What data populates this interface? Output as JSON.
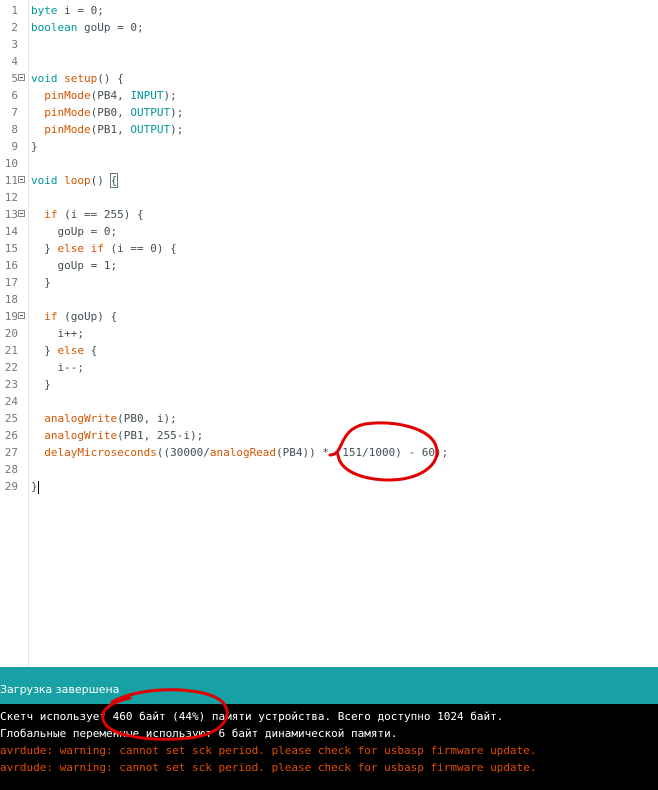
{
  "editor": {
    "lines": [
      {
        "n": "1",
        "fold": false,
        "tokens": [
          {
            "t": "byte",
            "c": "kw"
          },
          {
            "t": " i = 0;",
            "c": ""
          }
        ]
      },
      {
        "n": "2",
        "fold": false,
        "tokens": [
          {
            "t": "boolean",
            "c": "kw"
          },
          {
            "t": " goUp = 0;",
            "c": ""
          }
        ]
      },
      {
        "n": "3",
        "fold": false,
        "tokens": []
      },
      {
        "n": "4",
        "fold": false,
        "tokens": []
      },
      {
        "n": "5",
        "fold": true,
        "tokens": [
          {
            "t": "void",
            "c": "kw"
          },
          {
            "t": " ",
            "c": ""
          },
          {
            "t": "setup",
            "c": "fn"
          },
          {
            "t": "() {",
            "c": ""
          }
        ]
      },
      {
        "n": "6",
        "fold": false,
        "tokens": [
          {
            "t": "  ",
            "c": ""
          },
          {
            "t": "pinMode",
            "c": "fn"
          },
          {
            "t": "(PB4, ",
            "c": ""
          },
          {
            "t": "INPUT",
            "c": "cn"
          },
          {
            "t": ");",
            "c": ""
          }
        ]
      },
      {
        "n": "7",
        "fold": false,
        "tokens": [
          {
            "t": "  ",
            "c": ""
          },
          {
            "t": "pinMode",
            "c": "fn"
          },
          {
            "t": "(PB0, ",
            "c": ""
          },
          {
            "t": "OUTPUT",
            "c": "cn"
          },
          {
            "t": ");",
            "c": ""
          }
        ]
      },
      {
        "n": "8",
        "fold": false,
        "tokens": [
          {
            "t": "  ",
            "c": ""
          },
          {
            "t": "pinMode",
            "c": "fn"
          },
          {
            "t": "(PB1, ",
            "c": ""
          },
          {
            "t": "OUTPUT",
            "c": "cn"
          },
          {
            "t": ");",
            "c": ""
          }
        ]
      },
      {
        "n": "9",
        "fold": false,
        "tokens": [
          {
            "t": "}",
            "c": ""
          }
        ]
      },
      {
        "n": "10",
        "fold": false,
        "tokens": []
      },
      {
        "n": "11",
        "fold": true,
        "tokens": [
          {
            "t": "void",
            "c": "kw"
          },
          {
            "t": " ",
            "c": ""
          },
          {
            "t": "loop",
            "c": "fn"
          },
          {
            "t": "() ",
            "c": ""
          },
          {
            "t": "{",
            "c": "brk"
          }
        ]
      },
      {
        "n": "12",
        "fold": false,
        "tokens": []
      },
      {
        "n": "13",
        "fold": true,
        "tokens": [
          {
            "t": "  ",
            "c": ""
          },
          {
            "t": "if",
            "c": "fn"
          },
          {
            "t": " (i == 255) {",
            "c": ""
          }
        ]
      },
      {
        "n": "14",
        "fold": false,
        "tokens": [
          {
            "t": "    goUp = 0;",
            "c": ""
          }
        ]
      },
      {
        "n": "15",
        "fold": false,
        "tokens": [
          {
            "t": "  } ",
            "c": ""
          },
          {
            "t": "else",
            "c": "fn"
          },
          {
            "t": " ",
            "c": ""
          },
          {
            "t": "if",
            "c": "fn"
          },
          {
            "t": " (i == 0) {",
            "c": ""
          }
        ]
      },
      {
        "n": "16",
        "fold": false,
        "tokens": [
          {
            "t": "    goUp = 1;",
            "c": ""
          }
        ]
      },
      {
        "n": "17",
        "fold": false,
        "tokens": [
          {
            "t": "  }",
            "c": ""
          }
        ]
      },
      {
        "n": "18",
        "fold": false,
        "tokens": []
      },
      {
        "n": "19",
        "fold": true,
        "tokens": [
          {
            "t": "  ",
            "c": ""
          },
          {
            "t": "if",
            "c": "fn"
          },
          {
            "t": " (goUp) {",
            "c": ""
          }
        ]
      },
      {
        "n": "20",
        "fold": false,
        "tokens": [
          {
            "t": "    i++;",
            "c": ""
          }
        ]
      },
      {
        "n": "21",
        "fold": false,
        "tokens": [
          {
            "t": "  } ",
            "c": ""
          },
          {
            "t": "else",
            "c": "fn"
          },
          {
            "t": " {",
            "c": ""
          }
        ]
      },
      {
        "n": "22",
        "fold": false,
        "tokens": [
          {
            "t": "    i--;",
            "c": ""
          }
        ]
      },
      {
        "n": "23",
        "fold": false,
        "tokens": [
          {
            "t": "  }",
            "c": ""
          }
        ]
      },
      {
        "n": "24",
        "fold": false,
        "tokens": []
      },
      {
        "n": "25",
        "fold": false,
        "tokens": [
          {
            "t": "  ",
            "c": ""
          },
          {
            "t": "analogWrite",
            "c": "fn"
          },
          {
            "t": "(PB0, i);",
            "c": ""
          }
        ]
      },
      {
        "n": "26",
        "fold": false,
        "tokens": [
          {
            "t": "  ",
            "c": ""
          },
          {
            "t": "analogWrite",
            "c": "fn"
          },
          {
            "t": "(PB1, 255-i);",
            "c": ""
          }
        ]
      },
      {
        "n": "27",
        "fold": false,
        "tokens": [
          {
            "t": "  ",
            "c": ""
          },
          {
            "t": "delayMicroseconds",
            "c": "fn"
          },
          {
            "t": "((30000/",
            "c": ""
          },
          {
            "t": "analogRead",
            "c": "fn"
          },
          {
            "t": "(PB4)) * (151/1000) - 60);",
            "c": ""
          }
        ]
      },
      {
        "n": "28",
        "fold": false,
        "tokens": []
      },
      {
        "n": "29",
        "fold": false,
        "tokens": [
          {
            "t": "}",
            "c": ""
          },
          {
            "t": "CARET",
            "c": "caret"
          }
        ]
      }
    ]
  },
  "status": {
    "message": "Загрузка завершена"
  },
  "console": {
    "lines": [
      {
        "text": "Скетч использует 460 байт (44%) памяти устройства. Всего доступно 1024 байт.",
        "type": "white"
      },
      {
        "text": "Глобальные переменные используют 6 байт динамической памяти.",
        "type": "white"
      },
      {
        "text": "avrdude: warning: cannot set sck period. please check for usbasp firmware update.",
        "type": "warn"
      },
      {
        "text": "avrdude: warning: cannot set sck period. please check for usbasp firmware update.",
        "type": "warn"
      }
    ]
  },
  "colors": {
    "keyword": "#00979c",
    "function": "#d35400",
    "text": "#434f54",
    "status_bar": "#17a1a5",
    "console_bg": "#000000",
    "console_warning": "#e34c00",
    "annotation": "#e00000"
  }
}
